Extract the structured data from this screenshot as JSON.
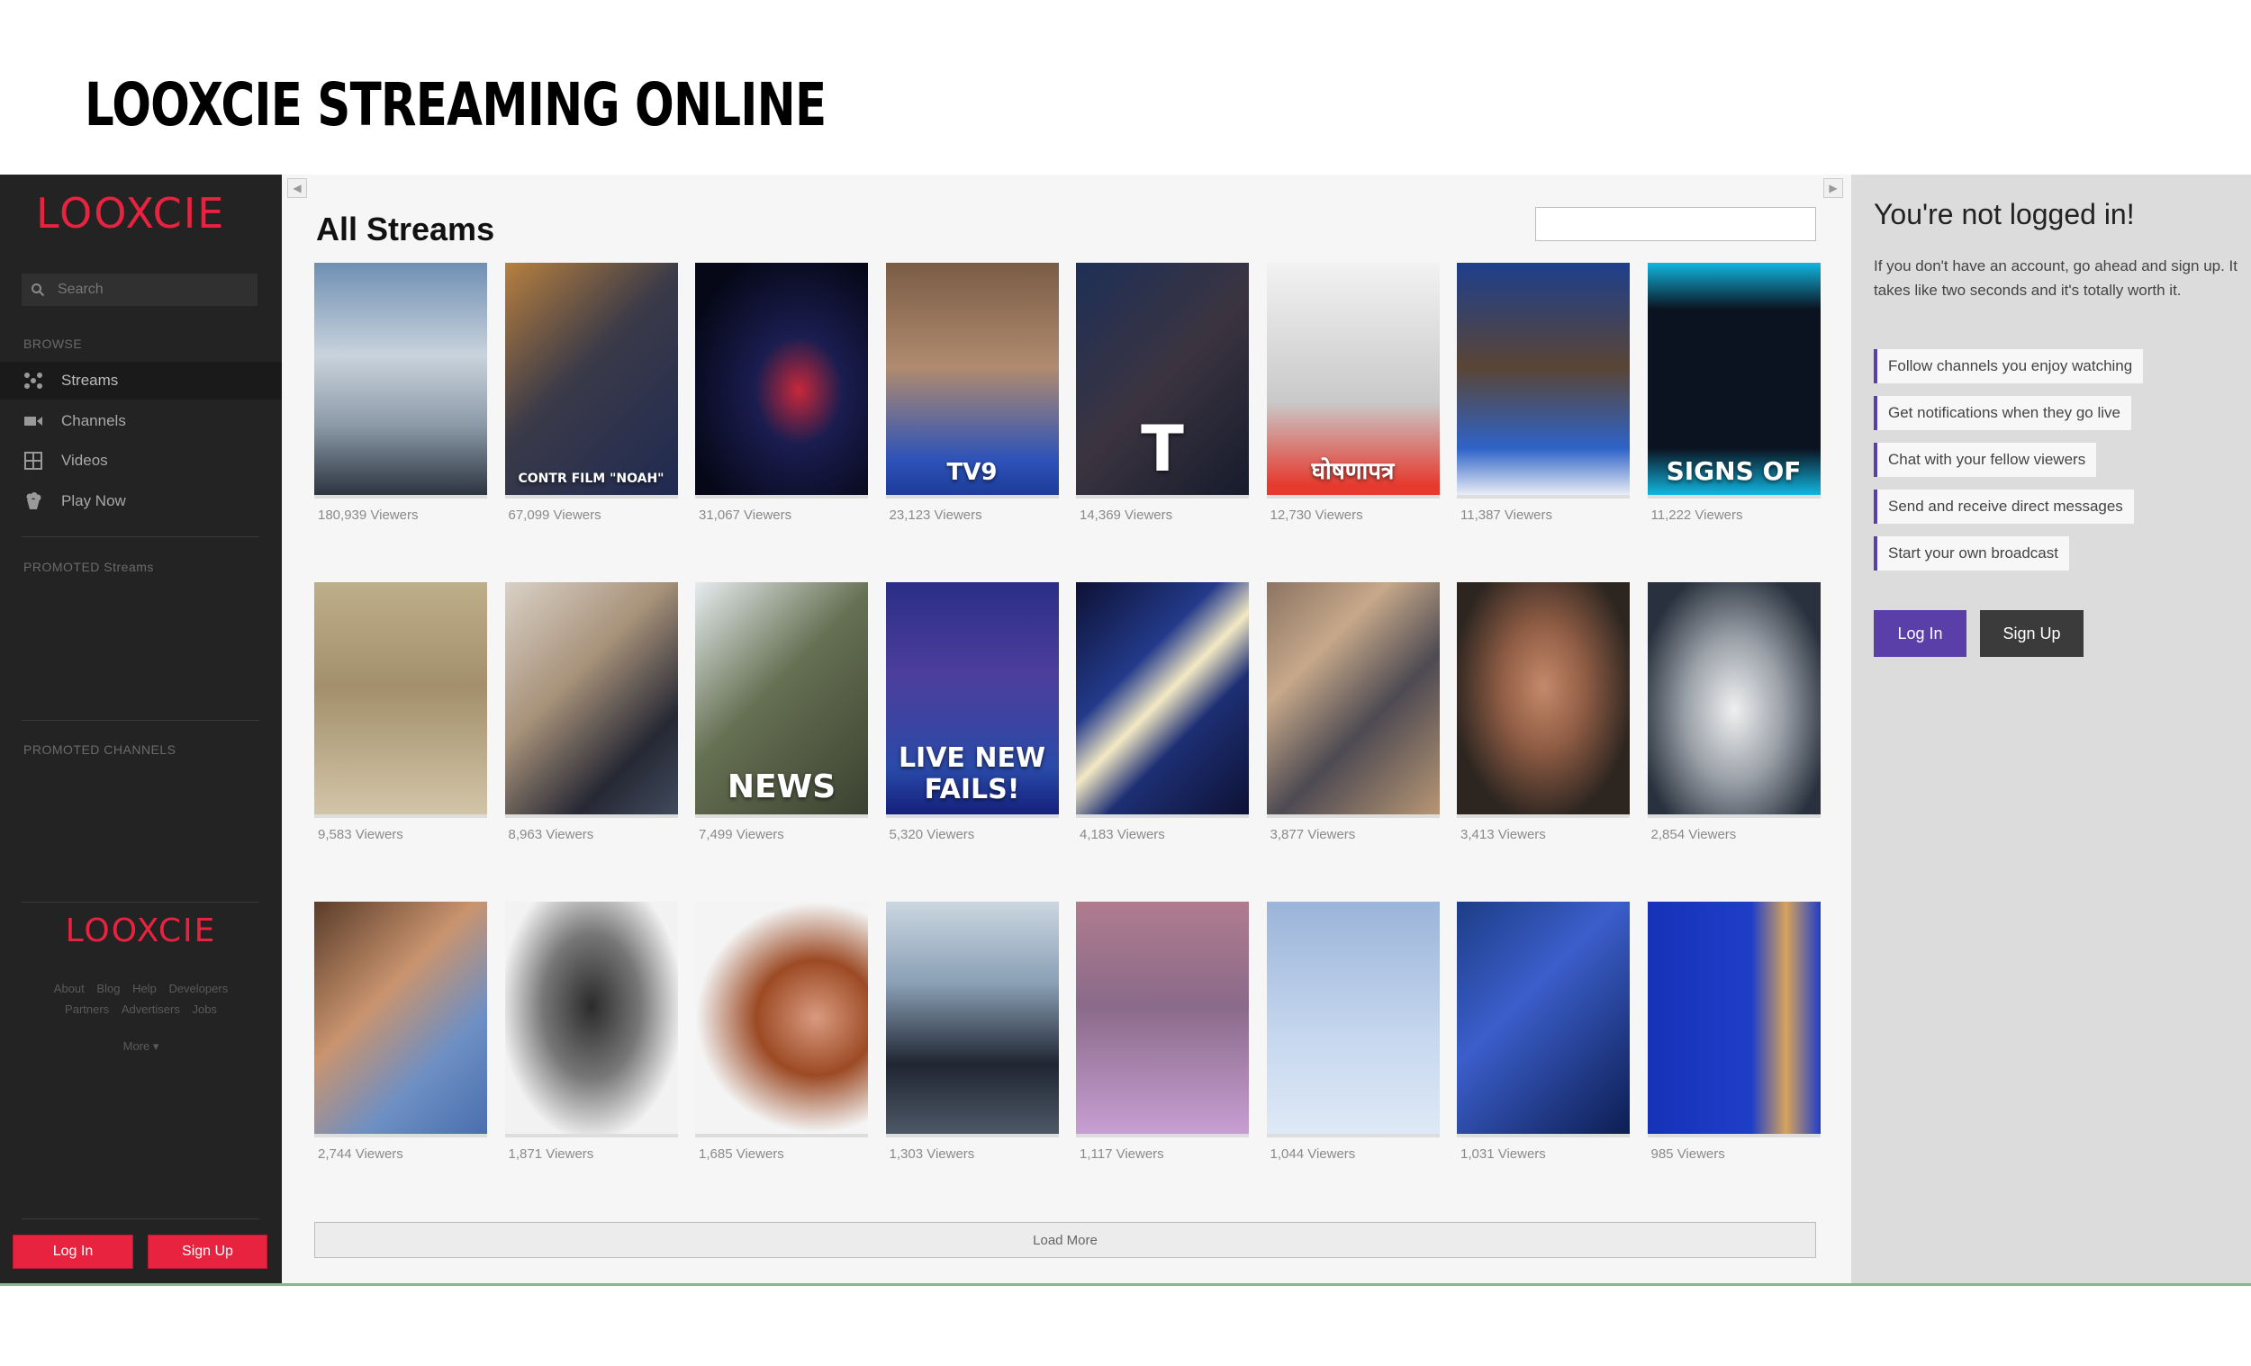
{
  "slide_title": "LOOXCIE STREAMING ONLINE",
  "sidebar": {
    "logo": "LOOXCIE",
    "search_placeholder": "Search",
    "browse_label": "BROWSE",
    "nav": [
      {
        "label": "Streams",
        "icon": "streams-icon"
      },
      {
        "label": "Channels",
        "icon": "video-camera-icon"
      },
      {
        "label": "Videos",
        "icon": "grid-icon"
      },
      {
        "label": "Play Now",
        "icon": "popcorn-icon"
      }
    ],
    "promoted_streams_label": "PROMOTED Streams",
    "promoted_channels_label": "PROMOTED CHANNELS",
    "footer_logo": "LOOXCIE",
    "footer_links_row1": [
      "About",
      "Blog",
      "Help",
      "Developers"
    ],
    "footer_links_row2": [
      "Partners",
      "Advertisers",
      "Jobs"
    ],
    "more_label": "More ▾",
    "login_label": "Log In",
    "signup_label": "Sign Up",
    "accent": "#e8233f"
  },
  "main": {
    "title": "All Streams",
    "load_more": "Load More",
    "streams": [
      {
        "viewers": "180,939 Viewers",
        "bg": "linear-gradient(180deg,#6f8fb3 0%,#c9d3dc 40%,#8c9aa8 70%,#2c3440 100%)"
      },
      {
        "viewers": "67,099 Viewers",
        "bg": "linear-gradient(135deg,#b8803f 0%,#3a3a48 45%,#1f2a52 100%)",
        "glyph": "CONTR FILM \"NOAH\"",
        "glyph_size": 14
      },
      {
        "viewers": "31,067 Viewers",
        "bg": "radial-gradient(ellipse at 60% 55%,#c8283a 0%,#1a1d4f 30%,#060818 80%)"
      },
      {
        "viewers": "23,123 Viewers",
        "bg": "linear-gradient(180deg,#7a5c45 0%,#b08b6f 45%,#2d52b8 85%,#1e3c9a 100%)",
        "glyph": "TV9",
        "glyph_size": 26
      },
      {
        "viewers": "14,369 Viewers",
        "bg": "linear-gradient(135deg,#1e2f57 0%,#3b3440 50%,#161b2c 100%)",
        "glyph": "T",
        "glyph_size": 70
      },
      {
        "viewers": "12,730 Viewers",
        "bg": "linear-gradient(180deg,#f2f2f2 0%,#c9c9c9 60%,#e63a2e 96%)",
        "glyph": "घोषणापत्र",
        "glyph_size": 26
      },
      {
        "viewers": "11,387 Viewers",
        "bg": "linear-gradient(180deg,#1e3f8c 0%,#5a4535 45%,#2e63c8 80%,#e9edf5 100%)"
      },
      {
        "viewers": "11,222 Viewers",
        "bg": "linear-gradient(180deg,#11b6e0 0%,#0b1320 20%,#0b1320 80%,#11b6e0 100%)",
        "glyph": "SIGNS OF",
        "glyph_size": 28
      },
      {
        "viewers": "9,583 Viewers",
        "bg": "linear-gradient(180deg,#bfae8a 0%,#a38f6b 45%,#d2c5a7 100%)"
      },
      {
        "viewers": "8,963 Viewers",
        "bg": "linear-gradient(135deg,#d9d1c7 0%,#a8927a 40%,#262834 75%,#404b5d 100%)"
      },
      {
        "viewers": "7,499 Viewers",
        "bg": "linear-gradient(135deg,#e6ecef 0%,#667052 45%,#3b4131 100%)",
        "glyph": "NEWS",
        "glyph_size": 36
      },
      {
        "viewers": "5,320 Viewers",
        "bg": "linear-gradient(180deg,#2a2e86 0%,#4d3e9c 40%,#2a4aa8 80%,#14207c 100%)",
        "glyph": "LIVE NEW FAILS!",
        "glyph_size": 30
      },
      {
        "viewers": "4,183 Viewers",
        "bg": "linear-gradient(135deg,#0d1134 0%,#233a8a 35%,#f3e9c3 50%,#1d2f73 65%,#0d1134 100%)"
      },
      {
        "viewers": "3,877 Viewers",
        "bg": "linear-gradient(135deg,#8c7463 0%,#c7a98a 30%,#4d4a52 60%,#b89674 100%)"
      },
      {
        "viewers": "3,413 Viewers",
        "bg": "radial-gradient(ellipse at 50% 45%,#c58a6b 0%,#8f5c44 35%,#2c2520 75%)"
      },
      {
        "viewers": "2,854 Viewers",
        "bg": "radial-gradient(ellipse at 50% 55%,#f0f0f0 0%,#9aa0a8 40%,#28313d 80%)"
      },
      {
        "viewers": "2,744 Viewers",
        "bg": "linear-gradient(135deg,#5a3c29 0%,#c9946f 40%,#6d8fc4 70%,#4a6fae 100%)"
      },
      {
        "viewers": "1,871 Viewers",
        "bg": "radial-gradient(ellipse at 50% 45%,#2b2b2b 0%,#777 40%,#f2f2f2 75%)"
      },
      {
        "viewers": "1,685 Viewers",
        "bg": "radial-gradient(ellipse at 70% 50%,#d99a7f 0%,#9c4a24 35%,#f4f4f4 70%)"
      },
      {
        "viewers": "1,303 Viewers",
        "bg": "linear-gradient(180deg,#cbd6e0 0%,#8aa0b6 35%,#202632 70%,#4d5866 100%)"
      },
      {
        "viewers": "1,117 Viewers",
        "bg": "linear-gradient(180deg,#b07c8e 0%,#8a6a8a 45%,#c79fd2 100%)"
      },
      {
        "viewers": "1,044 Viewers",
        "bg": "linear-gradient(180deg,#9bb4d9 0%,#c7d8ef 60%,#dfe9f6 100%)"
      },
      {
        "viewers": "1,031 Viewers",
        "bg": "linear-gradient(135deg,#1d3d86 0%,#3b5ecb 40%,#0d1e52 100%)"
      },
      {
        "viewers": "985 Viewers",
        "bg": "linear-gradient(90deg,#1532b8 0%,#1f3ec7 60%,#d7a35c 80%,#1f3ec7 100%)"
      }
    ]
  },
  "panel": {
    "heading": "You're not logged in!",
    "description": "If you don't have an account, go ahead and sign up. It takes like two seconds and it's totally worth it.",
    "features": [
      "Follow channels you enjoy watching",
      "Get notifications when they go live",
      "Chat with your fellow viewers",
      "Send and receive direct messages",
      "Start your own broadcast"
    ],
    "login_label": "Log In",
    "signup_label": "Sign Up",
    "login_color": "#5b3fa8",
    "signup_color": "#3b3b3b"
  }
}
